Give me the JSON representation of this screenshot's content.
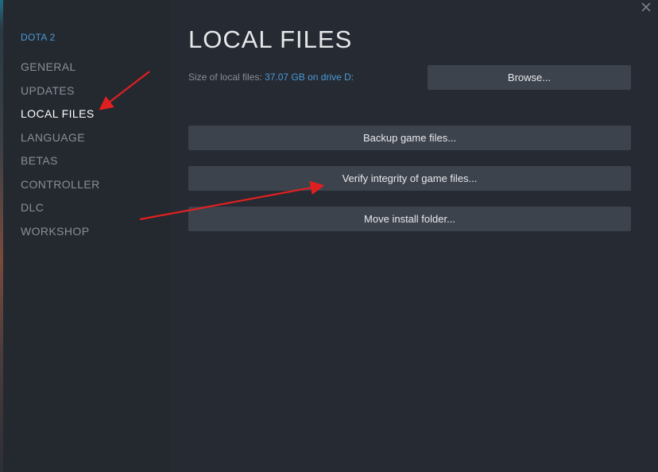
{
  "sidebar": {
    "game_title": "DOTA 2",
    "items": [
      {
        "label": "GENERAL",
        "active": false
      },
      {
        "label": "UPDATES",
        "active": false
      },
      {
        "label": "LOCAL FILES",
        "active": true
      },
      {
        "label": "LANGUAGE",
        "active": false
      },
      {
        "label": "BETAS",
        "active": false
      },
      {
        "label": "CONTROLLER",
        "active": false
      },
      {
        "label": "DLC",
        "active": false
      },
      {
        "label": "WORKSHOP",
        "active": false
      }
    ]
  },
  "main": {
    "title": "LOCAL FILES",
    "size_label": "Size of local files:",
    "size_value": "37.07 GB on drive D:",
    "browse_label": "Browse...",
    "backup_label": "Backup game files...",
    "verify_label": "Verify integrity of game files...",
    "move_label": "Move install folder..."
  },
  "window": {
    "close_icon": "close-icon"
  },
  "colors": {
    "accent": "#4c9bd6",
    "button": "#3d434d",
    "annotation_arrow": "#e02020"
  }
}
